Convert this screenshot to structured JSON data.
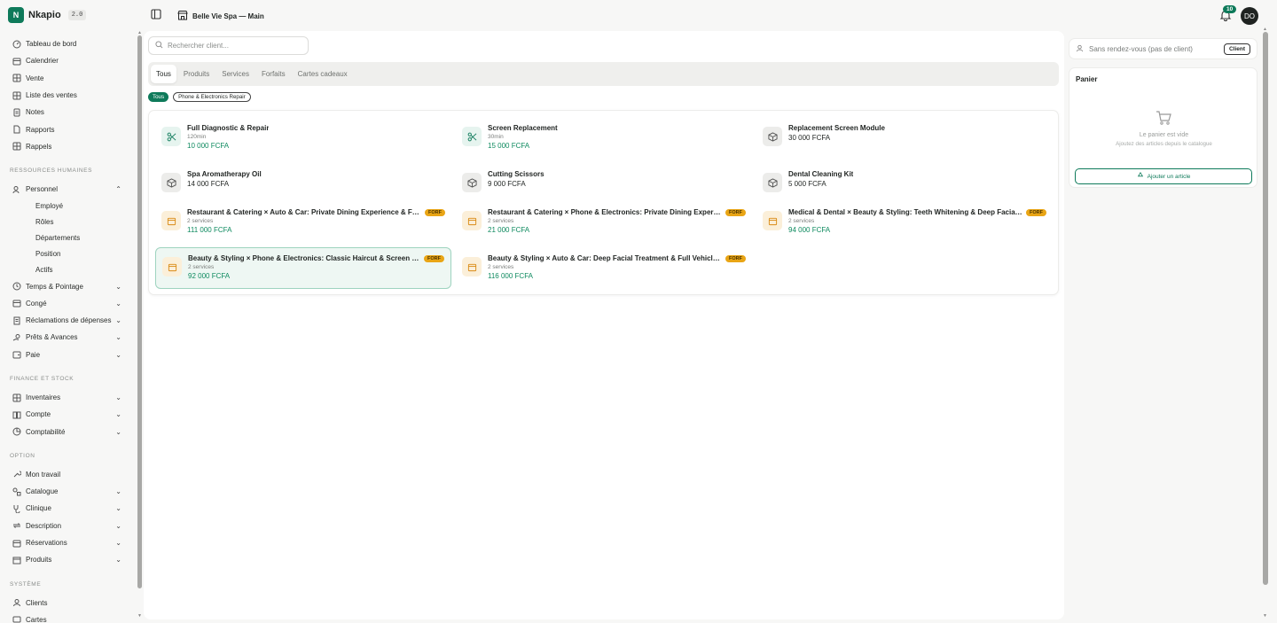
{
  "app": {
    "name": "Nkapio",
    "version": "2.0",
    "logo_letter": "N",
    "accent": "#0e7a5a"
  },
  "topbar": {
    "store_name": "Belle Vie Spa — Main",
    "notifications_count": "10",
    "avatar_initials": "DO"
  },
  "sidebar": {
    "items_top": [
      {
        "label": "Tableau de bord",
        "icon": "dashboard-icon"
      },
      {
        "label": "Calendrier",
        "icon": "calendar-icon"
      },
      {
        "label": "Vente",
        "icon": "grid-icon"
      },
      {
        "label": "Liste des ventes",
        "icon": "grid-icon"
      },
      {
        "label": "Notes",
        "icon": "document-icon"
      },
      {
        "label": "Rapports",
        "icon": "file-icon"
      },
      {
        "label": "Rappels",
        "icon": "grid-icon"
      }
    ],
    "section_hr": "Ressources humaines",
    "personnel": {
      "label": "Personnel",
      "subitems": [
        "Employé",
        "Rôles",
        "Départements",
        "Position",
        "Actifs"
      ]
    },
    "items_hr": [
      {
        "label": "Temps & Pointage"
      },
      {
        "label": "Congé"
      },
      {
        "label": "Réclamations de dépenses"
      },
      {
        "label": "Prêts & Avances"
      },
      {
        "label": "Paie"
      }
    ],
    "section_finance": "Finance et stock",
    "items_finance": [
      {
        "label": "Inventaires"
      },
      {
        "label": "Compte"
      },
      {
        "label": "Comptabilité"
      }
    ],
    "section_option": "Option",
    "mon_travail": "Mon travail",
    "items_option": [
      {
        "label": "Catalogue"
      },
      {
        "label": "Clinique"
      },
      {
        "label": "Description"
      },
      {
        "label": "Réservations"
      },
      {
        "label": "Produits"
      }
    ],
    "section_system": "Système",
    "items_system": [
      {
        "label": "Clients"
      },
      {
        "label": "Cartes"
      }
    ]
  },
  "catalog": {
    "search_placeholder": "Rechercher client...",
    "tabs": [
      "Tous",
      "Produits",
      "Services",
      "Forfaits",
      "Cartes cadeaux"
    ],
    "chips": [
      "Tous",
      "Phone & Electronics Repair"
    ],
    "items": [
      {
        "name": "Full Diagnostic & Repair",
        "sub": "120min",
        "price": "10 000 FCFA",
        "kind": "service"
      },
      {
        "name": "Screen Replacement",
        "sub": "30min",
        "price": "15 000 FCFA",
        "kind": "service"
      },
      {
        "name": "Replacement Screen Module",
        "sub": "",
        "price": "30 000 FCFA",
        "kind": "product"
      },
      {
        "name": "Spa Aromatherapy Oil",
        "sub": "",
        "price": "14 000 FCFA",
        "kind": "product"
      },
      {
        "name": "Cutting Scissors",
        "sub": "",
        "price": "9 000 FCFA",
        "kind": "product"
      },
      {
        "name": "Dental Cleaning Kit",
        "sub": "",
        "price": "5 000 FCFA",
        "kind": "product"
      },
      {
        "name": "Restaurant & Catering × Auto & Car: Private Dining Experience & Full Vehicle Inspection",
        "sub": "2 services",
        "price": "111 000 FCFA",
        "kind": "package",
        "badge": "FORF"
      },
      {
        "name": "Restaurant & Catering × Phone & Electronics: Private Dining Experience & Screen Replacement",
        "sub": "2 services",
        "price": "21 000 FCFA",
        "kind": "package",
        "badge": "FORF"
      },
      {
        "name": "Medical & Dental × Beauty & Styling: Teeth Whitening & Deep Facial Treatment",
        "sub": "2 services",
        "price": "94 000 FCFA",
        "kind": "package",
        "badge": "FORF"
      },
      {
        "name": "Beauty & Styling × Phone & Electronics: Classic Haircut & Screen Replacement",
        "sub": "2 services",
        "price": "92 000 FCFA",
        "kind": "package",
        "badge": "FORF",
        "selected": true
      },
      {
        "name": "Beauty & Styling × Auto & Car: Deep Facial Treatment & Full Vehicle Inspection",
        "sub": "2 services",
        "price": "116 000 FCFA",
        "kind": "package",
        "badge": "FORF"
      }
    ]
  },
  "cart": {
    "walkin_label": "Sans rendez-vous (pas de client)",
    "client_button": "Client",
    "title": "Panier",
    "empty": "Le panier est vide",
    "hint": "Ajoutez des articles depuis le catalogue",
    "add_button": "Ajouter un article"
  }
}
